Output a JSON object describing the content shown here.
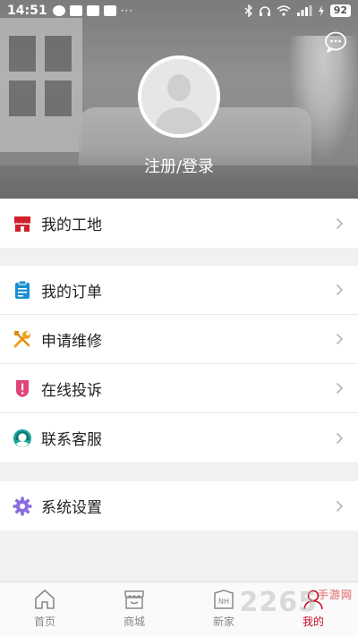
{
  "status_bar": {
    "time": "14:51",
    "dots": "···",
    "battery": "92"
  },
  "header": {
    "login_label": "注册/登录"
  },
  "menu_groups": [
    [
      {
        "label": "我的工地",
        "icon": "store-icon",
        "color": "#d0202a"
      }
    ],
    [
      {
        "label": "我的订单",
        "icon": "clipboard-icon",
        "color": "#1a8fd1"
      },
      {
        "label": "申请维修",
        "icon": "wrench-icon",
        "color": "#f0a020"
      },
      {
        "label": "在线投诉",
        "icon": "complaint-icon",
        "color": "#e0457a"
      },
      {
        "label": "联系客服",
        "icon": "headset-icon",
        "color": "#1aa39a"
      }
    ],
    [
      {
        "label": "系统设置",
        "icon": "gear-icon",
        "color": "#8a6ee0"
      }
    ]
  ],
  "tabs": [
    {
      "label": "首页",
      "icon": "home-icon",
      "active": false
    },
    {
      "label": "商城",
      "icon": "shop-icon",
      "active": false
    },
    {
      "label": "新家",
      "icon": "new-home-icon",
      "active": false
    },
    {
      "label": "我的",
      "icon": "profile-icon",
      "active": true
    }
  ],
  "watermark": {
    "text": "2265",
    "sub": "手游网"
  },
  "colors": {
    "accent": "#c0102a",
    "background": "#f1f1f1"
  }
}
